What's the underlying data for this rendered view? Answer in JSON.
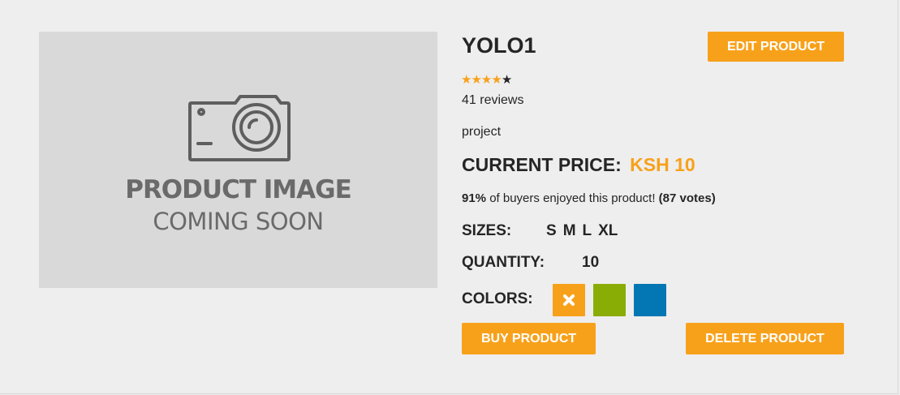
{
  "product": {
    "image_placeholder": {
      "line1": "PRODUCT IMAGE",
      "line2": "COMING SOON"
    },
    "title": "YOLO1",
    "rating": 4,
    "rating_max": 5,
    "reviews": "41 reviews",
    "description": "project",
    "price_label": "CURRENT PRICE:",
    "price_value": "KSH 10",
    "enjoy_percent": "91%",
    "enjoy_text": " of buyers enjoyed this product! ",
    "enjoy_votes": "(87 votes)",
    "sizes_label": "SIZES:",
    "sizes": [
      "S",
      "M",
      "L",
      "XL"
    ],
    "quantity_label": "QUANTITY:",
    "quantity": "10",
    "colors_label": "COLORS:",
    "colors": [
      "#f7a11b",
      "#8aad06",
      "#0277b3"
    ]
  },
  "buttons": {
    "edit": "EDIT PRODUCT",
    "buy": "BUY PRODUCT",
    "delete": "DELETE PRODUCT"
  },
  "theme": {
    "accent": "#f7a11b",
    "text": "#252525",
    "background": "#eeeeee",
    "placeholder_bg": "#d9d9d9"
  },
  "icons": {
    "camera": "camera-icon",
    "star": "star-icon",
    "selected_color": "close-icon"
  }
}
